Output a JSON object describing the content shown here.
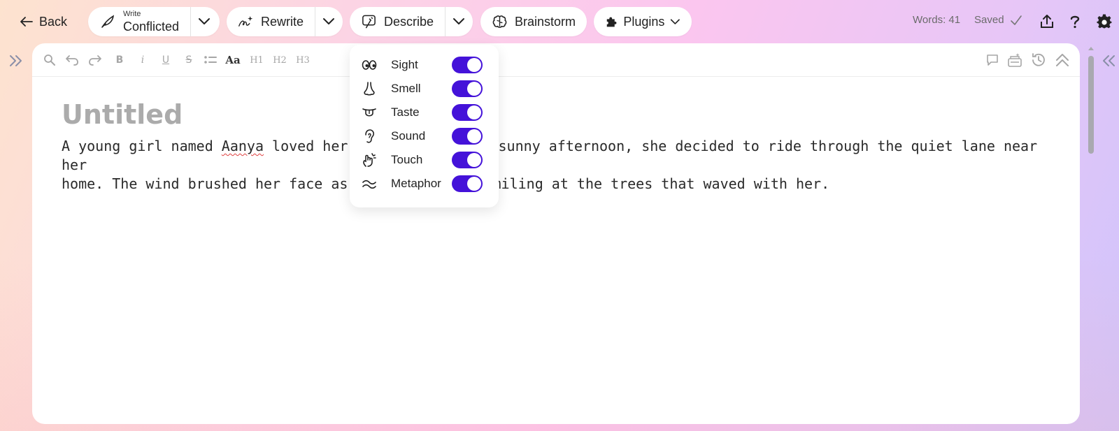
{
  "topbar": {
    "back_label": "Back",
    "write_small": "Write",
    "write_mode": "Conflicted",
    "rewrite_label": "Rewrite",
    "describe_label": "Describe",
    "brainstorm_label": "Brainstorm",
    "plugins_label": "Plugins",
    "words": "Words: 41",
    "saved": "Saved"
  },
  "toolbar": {
    "font_label": "Aa",
    "h1": "H1",
    "h2": "H2",
    "h3": "H3",
    "bold": "B",
    "italic": "i",
    "underline": "U",
    "strike": "S"
  },
  "editor": {
    "title_placeholder": "Untitled",
    "line1_before": "A young girl named ",
    "line1_misspelled": "Aanya",
    "line1_after": " loved her o",
    "line1_end": "sunny afternoon, she decided to ride through the quiet lane near her",
    "line2_start": "home. The wind brushed her face as",
    "line2_end": " smiling at the trees that waved with her."
  },
  "describe_menu": {
    "items": [
      {
        "label": "Sight",
        "icon": "eyes-icon",
        "enabled": true
      },
      {
        "label": "Smell",
        "icon": "nose-icon",
        "enabled": true
      },
      {
        "label": "Taste",
        "icon": "tongue-icon",
        "enabled": true
      },
      {
        "label": "Sound",
        "icon": "ear-icon",
        "enabled": true
      },
      {
        "label": "Touch",
        "icon": "hand-icon",
        "enabled": true
      },
      {
        "label": "Metaphor",
        "icon": "waves-icon",
        "enabled": true
      }
    ]
  },
  "colors": {
    "toggle_on": "#4412d9",
    "spell_error": "#e04040"
  }
}
